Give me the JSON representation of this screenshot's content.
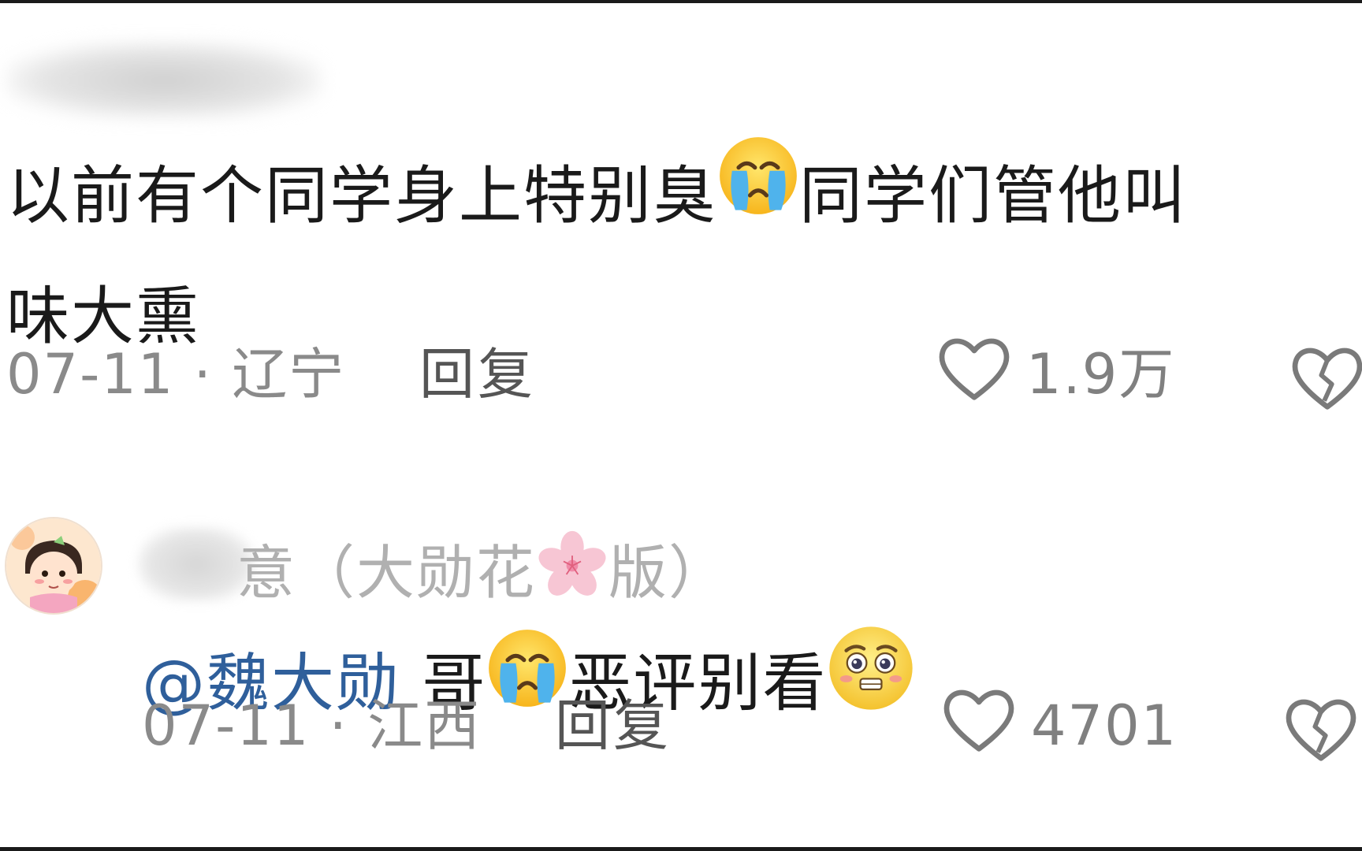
{
  "comment1": {
    "text_part1": "以前有个同学身上特别臭",
    "text_part2": "同学们管他叫",
    "text_part3": "味大熏",
    "date": "07-11",
    "separator": "·",
    "location": "辽宁",
    "reply_label": "回复",
    "like_count": "1.9万"
  },
  "comment2": {
    "username_visible": "意（大勋花",
    "username_suffix": "版）",
    "mention": "@魏大勋",
    "text_part1": " 哥",
    "text_part2": "恶评别看",
    "date": "07-11",
    "separator": "·",
    "location": "江西",
    "reply_label": "回复",
    "like_count": "4701"
  },
  "icons": {
    "like": "heart-outline-icon",
    "dislike": "broken-heart-icon",
    "emoji_crying": "loudly-crying-face-emoji",
    "emoji_pleading": "pleading-face-emoji",
    "emoji_flower": "cherry-blossom-emoji"
  },
  "colors": {
    "mention": "#2f5f9b",
    "meta": "#8a8a8a",
    "text": "#1a1a1a"
  }
}
